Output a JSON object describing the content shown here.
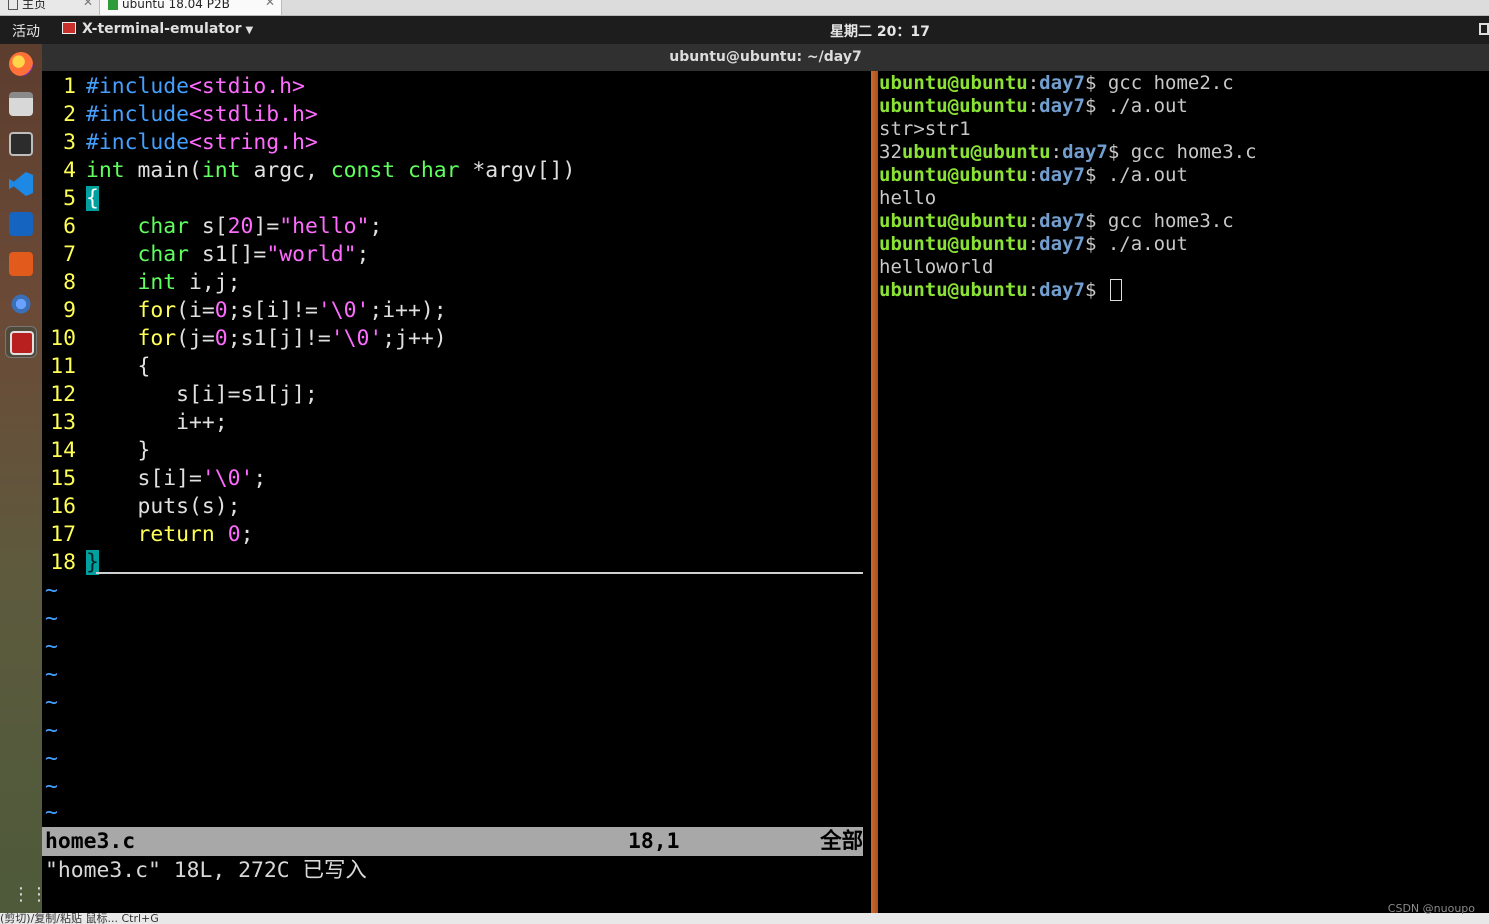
{
  "vm_tabs": [
    {
      "label": "主页",
      "close": "✕"
    },
    {
      "label": "ubuntu 18.04 P2B",
      "close": "✕"
    }
  ],
  "topbar": {
    "activities": "活动",
    "app_menu": "X-terminal-emulator",
    "clock": "星期二 20：17"
  },
  "window": {
    "title": "ubuntu@ubuntu: ~/day7"
  },
  "dock": {
    "items": [
      "firefox-icon",
      "files-icon",
      "terminal-icon",
      "vscode-icon",
      "vnc-icon",
      "software-icon",
      "settings-icon",
      "xterm-icon"
    ],
    "apps_grid": "⋮⋮⋮"
  },
  "vim": {
    "line_numbers": [
      "1",
      "2",
      "3",
      "4",
      "5",
      "6",
      "7",
      "8",
      "9",
      "10",
      "11",
      "12",
      "13",
      "14",
      "15",
      "16",
      "17",
      "18"
    ],
    "code_text": {
      "l1a": "#include",
      "l1b": "<stdio.h>",
      "l2a": "#include",
      "l2b": "<stdlib.h>",
      "l3a": "#include",
      "l3b": "<string.h>",
      "l4a": "int",
      "l4b": " main(",
      "l4c": "int",
      "l4d": " argc, ",
      "l4e": "const",
      "l4f": " ",
      "l4g": "char",
      "l4h": " *argv[])",
      "l5": "{",
      "l6a": "    char",
      "l6b": " s[",
      "l6c": "20",
      "l6d": "]=",
      "l6e": "\"hello\"",
      "l6f": ";",
      "l7a": "    char",
      "l7b": " s1[]=",
      "l7c": "\"world\"",
      "l7d": ";",
      "l8a": "    int",
      "l8b": " i,j;",
      "l9a": "    for",
      "l9b": "(i=",
      "l9c": "0",
      "l9d": ";s[i]!=",
      "l9e": "'\\0'",
      "l9f": ";i++);",
      "l10a": "    for",
      "l10b": "(j=",
      "l10c": "0",
      "l10d": ";s1[j]!=",
      "l10e": "'\\0'",
      "l10f": ";j++)",
      "l11": "    {",
      "l12": "       s[i]=s1[j];",
      "l13": "       i++;",
      "l14": "    }",
      "l15a": "    s[i]=",
      "l15b": "'\\0'",
      "l15c": ";",
      "l16": "    puts(s);",
      "l17a": "    return",
      "l17b": " ",
      "l17c": "0",
      "l17d": ";",
      "l18": "}"
    },
    "tilde": "~",
    "status": {
      "filename": "home3.c",
      "position": "18,1",
      "scroll": "全部"
    },
    "message": "\"home3.c\" 18L, 272C 已写入"
  },
  "shell": {
    "user": "ubuntu@ubuntu",
    "colon": ":",
    "path": "day7",
    "prompt_suffix": "$ ",
    "lines": {
      "c1": "gcc home2.c",
      "c2": "./a.out",
      "o1": "str>str1",
      "o2_prefix": "32",
      "c3": "gcc home3.c",
      "c4": "./a.out",
      "o3": "hello",
      "c5": "gcc home3.c",
      "c6": "./a.out",
      "o4": "helloworld"
    }
  },
  "bottom_strip": {
    "text": "(剪切)/复制/粘贴 鼠标... Ctrl+G"
  },
  "watermark": "CSDN @nuoupo",
  "colors": {
    "dock_bg": "#5c3d2e",
    "vim_statusline": "#a8a8a8",
    "prompt_user": "#8ae234",
    "prompt_path": "#729fcf",
    "divider": "#d06a2a"
  }
}
